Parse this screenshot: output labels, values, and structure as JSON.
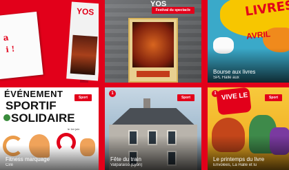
{
  "cards": [
    {
      "title": "",
      "place": "",
      "badge": "",
      "poster_text": "YOS",
      "paper_text": "i !",
      "paper_top": "a"
    },
    {
      "title": "",
      "place": "",
      "badge": "Festival du spectacle",
      "poster_text": "YOS"
    },
    {
      "title": "Bourse aux livres",
      "place": "SPL Halle aux",
      "badge": "",
      "word": "LIVRES",
      "sub_word": "AVRIL"
    },
    {
      "title": "Fitness marquage",
      "place": "Ciré",
      "badge": "Sport",
      "line1_a": "ÉVÉNEMENT",
      "line2": "SPORTIF",
      "line3": "SOLIDAIRE",
      "sub": "le 1er juin"
    },
    {
      "title": "Fête du train",
      "place": "Valparaiso (Lyon)",
      "badge": "Sport",
      "number": "1"
    },
    {
      "title": "Le printemps du livre",
      "place": "Envolées, La Halle et lu",
      "badge": "Sport",
      "number": "1",
      "logo": "VIVE LE"
    }
  ],
  "colors": {
    "brand_red": "#e2001a"
  }
}
